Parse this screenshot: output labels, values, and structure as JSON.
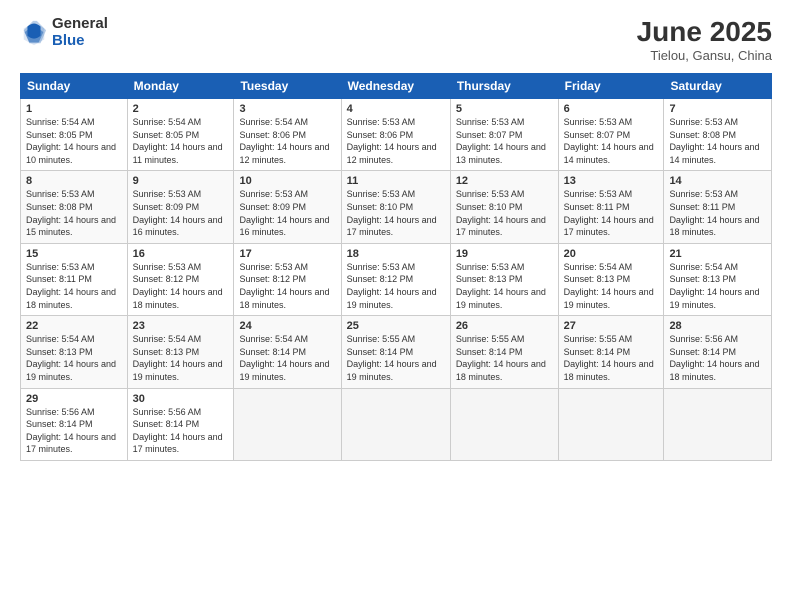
{
  "logo": {
    "general": "General",
    "blue": "Blue"
  },
  "header": {
    "title": "June 2025",
    "subtitle": "Tielou, Gansu, China"
  },
  "weekdays": [
    "Sunday",
    "Monday",
    "Tuesday",
    "Wednesday",
    "Thursday",
    "Friday",
    "Saturday"
  ],
  "weeks": [
    [
      {
        "day": "1",
        "sunrise": "Sunrise: 5:54 AM",
        "sunset": "Sunset: 8:05 PM",
        "daylight": "Daylight: 14 hours and 10 minutes."
      },
      {
        "day": "2",
        "sunrise": "Sunrise: 5:54 AM",
        "sunset": "Sunset: 8:05 PM",
        "daylight": "Daylight: 14 hours and 11 minutes."
      },
      {
        "day": "3",
        "sunrise": "Sunrise: 5:54 AM",
        "sunset": "Sunset: 8:06 PM",
        "daylight": "Daylight: 14 hours and 12 minutes."
      },
      {
        "day": "4",
        "sunrise": "Sunrise: 5:53 AM",
        "sunset": "Sunset: 8:06 PM",
        "daylight": "Daylight: 14 hours and 12 minutes."
      },
      {
        "day": "5",
        "sunrise": "Sunrise: 5:53 AM",
        "sunset": "Sunset: 8:07 PM",
        "daylight": "Daylight: 14 hours and 13 minutes."
      },
      {
        "day": "6",
        "sunrise": "Sunrise: 5:53 AM",
        "sunset": "Sunset: 8:07 PM",
        "daylight": "Daylight: 14 hours and 14 minutes."
      },
      {
        "day": "7",
        "sunrise": "Sunrise: 5:53 AM",
        "sunset": "Sunset: 8:08 PM",
        "daylight": "Daylight: 14 hours and 14 minutes."
      }
    ],
    [
      {
        "day": "8",
        "sunrise": "Sunrise: 5:53 AM",
        "sunset": "Sunset: 8:08 PM",
        "daylight": "Daylight: 14 hours and 15 minutes."
      },
      {
        "day": "9",
        "sunrise": "Sunrise: 5:53 AM",
        "sunset": "Sunset: 8:09 PM",
        "daylight": "Daylight: 14 hours and 16 minutes."
      },
      {
        "day": "10",
        "sunrise": "Sunrise: 5:53 AM",
        "sunset": "Sunset: 8:09 PM",
        "daylight": "Daylight: 14 hours and 16 minutes."
      },
      {
        "day": "11",
        "sunrise": "Sunrise: 5:53 AM",
        "sunset": "Sunset: 8:10 PM",
        "daylight": "Daylight: 14 hours and 17 minutes."
      },
      {
        "day": "12",
        "sunrise": "Sunrise: 5:53 AM",
        "sunset": "Sunset: 8:10 PM",
        "daylight": "Daylight: 14 hours and 17 minutes."
      },
      {
        "day": "13",
        "sunrise": "Sunrise: 5:53 AM",
        "sunset": "Sunset: 8:11 PM",
        "daylight": "Daylight: 14 hours and 17 minutes."
      },
      {
        "day": "14",
        "sunrise": "Sunrise: 5:53 AM",
        "sunset": "Sunset: 8:11 PM",
        "daylight": "Daylight: 14 hours and 18 minutes."
      }
    ],
    [
      {
        "day": "15",
        "sunrise": "Sunrise: 5:53 AM",
        "sunset": "Sunset: 8:11 PM",
        "daylight": "Daylight: 14 hours and 18 minutes."
      },
      {
        "day": "16",
        "sunrise": "Sunrise: 5:53 AM",
        "sunset": "Sunset: 8:12 PM",
        "daylight": "Daylight: 14 hours and 18 minutes."
      },
      {
        "day": "17",
        "sunrise": "Sunrise: 5:53 AM",
        "sunset": "Sunset: 8:12 PM",
        "daylight": "Daylight: 14 hours and 18 minutes."
      },
      {
        "day": "18",
        "sunrise": "Sunrise: 5:53 AM",
        "sunset": "Sunset: 8:12 PM",
        "daylight": "Daylight: 14 hours and 19 minutes."
      },
      {
        "day": "19",
        "sunrise": "Sunrise: 5:53 AM",
        "sunset": "Sunset: 8:13 PM",
        "daylight": "Daylight: 14 hours and 19 minutes."
      },
      {
        "day": "20",
        "sunrise": "Sunrise: 5:54 AM",
        "sunset": "Sunset: 8:13 PM",
        "daylight": "Daylight: 14 hours and 19 minutes."
      },
      {
        "day": "21",
        "sunrise": "Sunrise: 5:54 AM",
        "sunset": "Sunset: 8:13 PM",
        "daylight": "Daylight: 14 hours and 19 minutes."
      }
    ],
    [
      {
        "day": "22",
        "sunrise": "Sunrise: 5:54 AM",
        "sunset": "Sunset: 8:13 PM",
        "daylight": "Daylight: 14 hours and 19 minutes."
      },
      {
        "day": "23",
        "sunrise": "Sunrise: 5:54 AM",
        "sunset": "Sunset: 8:13 PM",
        "daylight": "Daylight: 14 hours and 19 minutes."
      },
      {
        "day": "24",
        "sunrise": "Sunrise: 5:54 AM",
        "sunset": "Sunset: 8:14 PM",
        "daylight": "Daylight: 14 hours and 19 minutes."
      },
      {
        "day": "25",
        "sunrise": "Sunrise: 5:55 AM",
        "sunset": "Sunset: 8:14 PM",
        "daylight": "Daylight: 14 hours and 19 minutes."
      },
      {
        "day": "26",
        "sunrise": "Sunrise: 5:55 AM",
        "sunset": "Sunset: 8:14 PM",
        "daylight": "Daylight: 14 hours and 18 minutes."
      },
      {
        "day": "27",
        "sunrise": "Sunrise: 5:55 AM",
        "sunset": "Sunset: 8:14 PM",
        "daylight": "Daylight: 14 hours and 18 minutes."
      },
      {
        "day": "28",
        "sunrise": "Sunrise: 5:56 AM",
        "sunset": "Sunset: 8:14 PM",
        "daylight": "Daylight: 14 hours and 18 minutes."
      }
    ],
    [
      {
        "day": "29",
        "sunrise": "Sunrise: 5:56 AM",
        "sunset": "Sunset: 8:14 PM",
        "daylight": "Daylight: 14 hours and 17 minutes."
      },
      {
        "day": "30",
        "sunrise": "Sunrise: 5:56 AM",
        "sunset": "Sunset: 8:14 PM",
        "daylight": "Daylight: 14 hours and 17 minutes."
      },
      null,
      null,
      null,
      null,
      null
    ]
  ]
}
